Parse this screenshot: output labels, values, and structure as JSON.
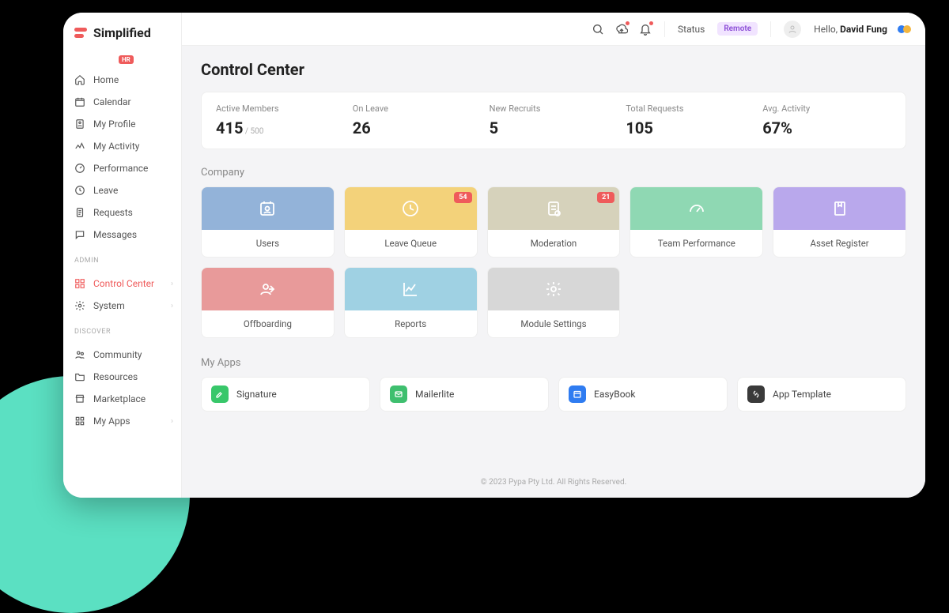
{
  "brand": {
    "name": "Simplified",
    "tag": "HR"
  },
  "sidebar": {
    "main": [
      {
        "label": "Home"
      },
      {
        "label": "Calendar"
      },
      {
        "label": "My Profile"
      },
      {
        "label": "My Activity"
      },
      {
        "label": "Performance"
      },
      {
        "label": "Leave"
      },
      {
        "label": "Requests"
      },
      {
        "label": "Messages"
      }
    ],
    "admin_heading": "ADMIN",
    "admin": [
      {
        "label": "Control Center"
      },
      {
        "label": "System"
      }
    ],
    "discover_heading": "DISCOVER",
    "discover": [
      {
        "label": "Community"
      },
      {
        "label": "Resources"
      },
      {
        "label": "Marketplace"
      },
      {
        "label": "My Apps"
      }
    ]
  },
  "topbar": {
    "status_label": "Status",
    "status_value": "Remote",
    "greeting": "Hello, ",
    "user_name": "David Fung"
  },
  "page": {
    "title": "Control Center"
  },
  "stats": [
    {
      "label": "Active Members",
      "value": "415",
      "sub": " / 500"
    },
    {
      "label": "On Leave",
      "value": "26",
      "sub": ""
    },
    {
      "label": "New Recruits",
      "value": "5",
      "sub": ""
    },
    {
      "label": "Total Requests",
      "value": "105",
      "sub": ""
    },
    {
      "label": "Avg. Activity",
      "value": "67%",
      "sub": ""
    }
  ],
  "company_heading": "Company",
  "tiles": [
    {
      "label": "Users",
      "color": "#93b3d9",
      "badge": ""
    },
    {
      "label": "Leave Queue",
      "color": "#f3d27a",
      "badge": "54"
    },
    {
      "label": "Moderation",
      "color": "#d6d2bb",
      "badge": "21"
    },
    {
      "label": "Team Performance",
      "color": "#8fd8b3",
      "badge": ""
    },
    {
      "label": "Asset Register",
      "color": "#b9a8ec",
      "badge": ""
    },
    {
      "label": "Offboarding",
      "color": "#e89a9a",
      "badge": ""
    },
    {
      "label": "Reports",
      "color": "#9fd1e3",
      "badge": ""
    },
    {
      "label": "Module Settings",
      "color": "#d7d7d7",
      "badge": ""
    }
  ],
  "apps_heading": "My Apps",
  "apps": [
    {
      "label": "Signature",
      "color": "#38c76a"
    },
    {
      "label": "Mailerlite",
      "color": "#3fbf6f"
    },
    {
      "label": "EasyBook",
      "color": "#2f7cf1"
    },
    {
      "label": "App Template",
      "color": "#3a3a3a"
    }
  ],
  "footer": "© 2023 Pypa Pty Ltd. All Rights Reserved."
}
